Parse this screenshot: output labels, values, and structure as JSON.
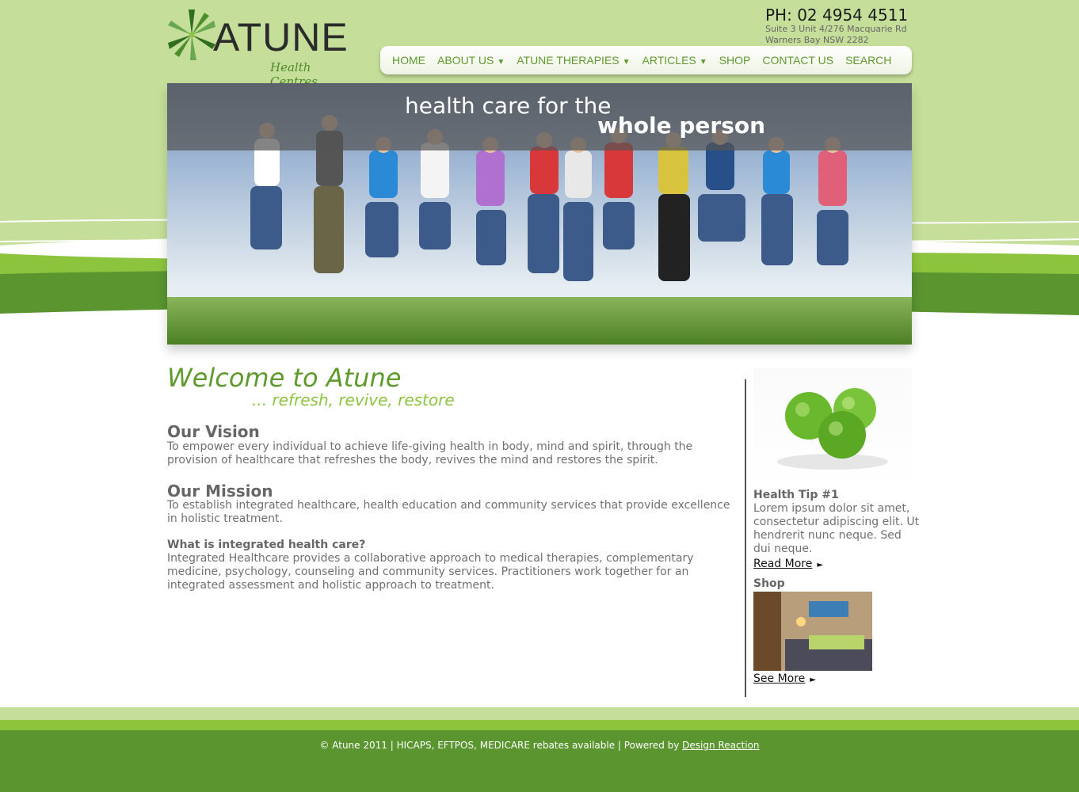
{
  "header": {
    "logo_word": "ATUNE",
    "logo_sub": "Health Centres",
    "phone": "PH: 02 4954 4511",
    "address_line1": "Suite 3 Unit 4/276 Macquarie Rd",
    "address_line2": "Warners Bay NSW 2282"
  },
  "nav": {
    "home": "HOME",
    "about": "ABOUT US",
    "therapies": "ATUNE THERAPIES",
    "articles": "ARTICLES",
    "shop": "SHOP",
    "contact": "CONTACT US",
    "search": "SEARCH",
    "caret": "▼"
  },
  "hero": {
    "line1": "health care for the",
    "line2": "whole person"
  },
  "main": {
    "welcome": "Welcome to Atune",
    "tagline": "... refresh, revive, restore",
    "vision_heading": "Our Vision",
    "vision_text": "To empower every individual to achieve life-giving health in body, mind and spirit, through the provision of healthcare that refreshes the body, revives the mind and restores the spirit.",
    "mission_heading": "Our Mission",
    "mission_text": "To establish integrated healthcare, health education and community services that provide excellence in holistic treatment.",
    "integrated_heading": "What is integrated health care?",
    "integrated_text": "Integrated Healthcare provides a collaborative approach to medical therapies, complementary medicine, psychology, counseling and community services. Practitioners work together for an integrated assessment and holistic approach to treatment."
  },
  "sidebar": {
    "tip_title": "Health Tip #1",
    "tip_text": "Lorem ipsum dolor sit amet, consectetur adipiscing elit. Ut hendrerit nunc neque. Sed dui neque.",
    "read_more": "Read More",
    "shop_title": "Shop",
    "see_more": "See More",
    "arrow": "►"
  },
  "footer": {
    "text": "© Atune 2011 | HICAPS, EFTPOS, MEDICARE rebates available | Powered by",
    "link": "Design Reaction"
  },
  "colors": {
    "light_green": "#c5df9a",
    "accent_green": "#5e9b2c",
    "bright_green": "#8cc43e",
    "footer_green": "#5a9530"
  }
}
